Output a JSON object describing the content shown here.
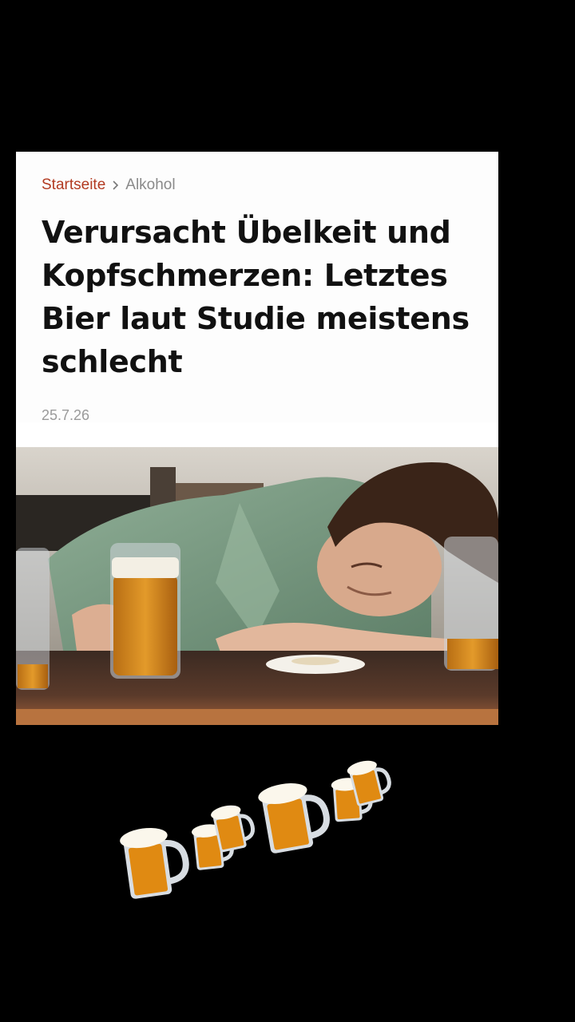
{
  "breadcrumb": {
    "home": "Startseite",
    "current": "Alkohol"
  },
  "article": {
    "headline": "Verursacht Übelkeit und Kopfschmerzen: Letztes Bier laut Studie meistens schlecht",
    "date": "25.7.26"
  },
  "hero_image": {
    "alt": "",
    "icon": "photo-man-asleep-at-table-with-beer"
  },
  "decoration": {
    "icon": "beer-mug-emoji",
    "count": 6,
    "colors": {
      "beer": "#e08a12",
      "foam": "#fbf7ec",
      "glass": "#d8dde2"
    }
  },
  "colors": {
    "background": "#000000",
    "card": "#ffffff",
    "accent": "#b23a21",
    "headline": "#111111",
    "muted": "#9a9a9a"
  }
}
